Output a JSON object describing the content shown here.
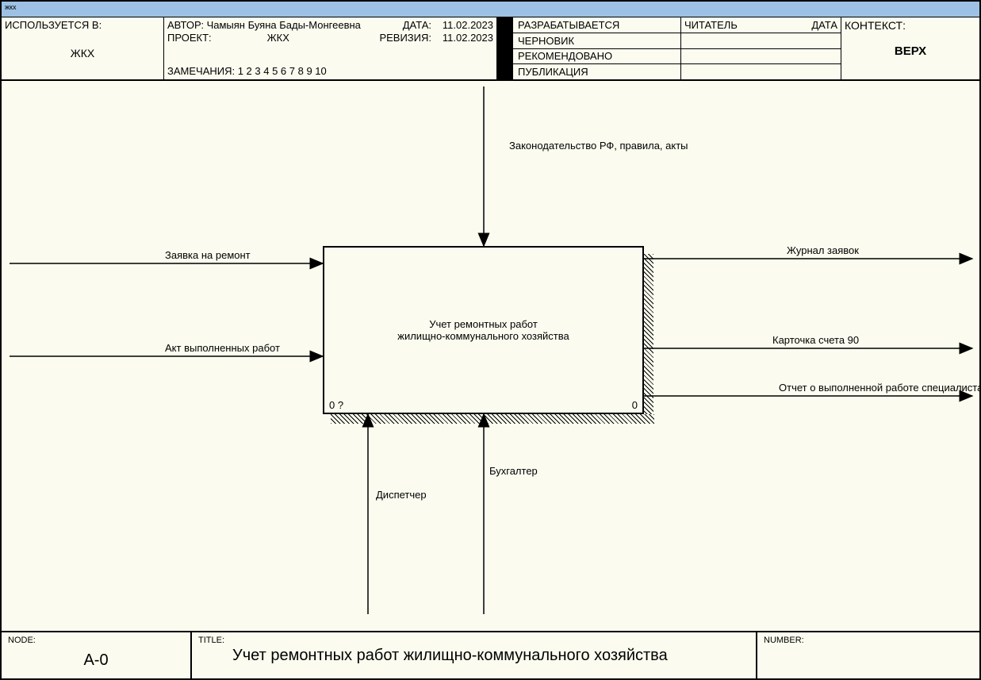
{
  "window_title": "жкх",
  "header": {
    "used_at_label": "ИСПОЛЬЗУЕТСЯ В:",
    "used_at_value": "ЖКХ",
    "author_label": "АВТОР:",
    "author_value": "Чамыян Буяна Бады-Монгеевна",
    "project_label": "ПРОЕКТ:",
    "project_value": "ЖКХ",
    "notes_label": "ЗАМЕЧАНИЯ:",
    "notes_value": "1 2 3 4 5 6 7 8 9 10",
    "date_label": "ДАТА:",
    "date_value": "11.02.2023",
    "revision_label": "РЕВИЗИЯ:",
    "revision_value": "11.02.2023",
    "statuses": [
      "РАЗРАБАТЫВАЕТСЯ",
      "ЧЕРНОВИК",
      "РЕКОМЕНДОВАНО",
      "ПУБЛИКАЦИЯ"
    ],
    "reader_label": "ЧИТАТЕЛЬ",
    "reader_date_label": "ДАТА",
    "context_label": "КОНТЕКСТ:",
    "context_value": "ВЕРХ"
  },
  "diagram": {
    "activity": {
      "title_line1": "Учет ремонтных работ",
      "title_line2": "жилищно-коммунального хозяйства",
      "left_node_id": "0 ?",
      "right_node_id": "0"
    },
    "control_top": "Законодательство РФ, правила, акты",
    "inputs": [
      "Заявка на ремонт",
      "Акт выполненных работ"
    ],
    "outputs": [
      "Журнал заявок",
      "Карточка счета 90",
      "Отчет о выполненной работе специалиста"
    ],
    "mechanisms": [
      "Диспетчер",
      "Бухгалтер"
    ]
  },
  "footer": {
    "node_label": "NODE:",
    "node_value": "A-0",
    "title_label": "TITLE:",
    "title_value": "Учет ремонтных работ жилищно-коммунального хозяйства",
    "number_label": "NUMBER:"
  }
}
